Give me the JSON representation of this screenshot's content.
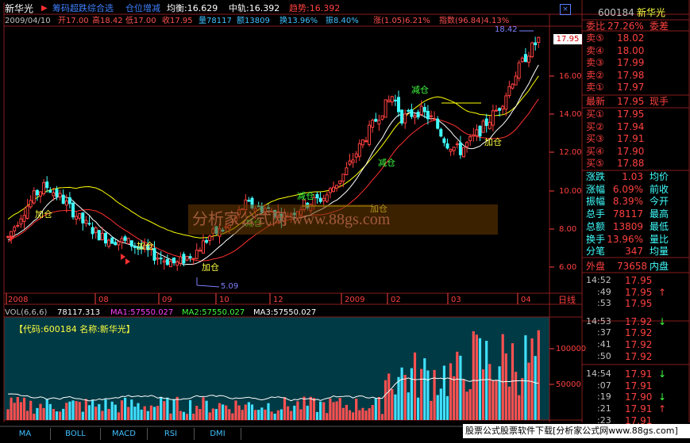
{
  "header": {
    "stock_name": "新华光",
    "indicator_title": "筹码超跌综合选",
    "indicator_sub": "仓位增减",
    "avg_label": "均衡:16.629",
    "mid_label": "中轨:16.392",
    "trend_label": "趋势:16.392"
  },
  "ohlc_line": {
    "date": "2009/04/10",
    "open": "开17.00",
    "high": "高18.42",
    "low": "低17.00",
    "close": "收17.95",
    "volume": "量78117",
    "amount": "额13809",
    "turnover": "换13.96%",
    "amplitude": "振8.40%",
    "change": "涨(1.05)6.21%",
    "index": "指数(96.84)4.13%"
  },
  "price_axis": [
    "16.00",
    "14.00",
    "12.00",
    "10.00",
    "8.00",
    "6.00"
  ],
  "current_price_tag": "17.95",
  "high_marker": "18.42",
  "low_marker": "5.09",
  "signals": [
    {
      "text": "加仓",
      "color": "#ffff40"
    },
    {
      "text": "加仓",
      "color": "#ffff40"
    },
    {
      "text": "加仓",
      "color": "#ffff40"
    },
    {
      "text": "减仓",
      "color": "#40ff40"
    },
    {
      "text": "减仓",
      "color": "#40ff40"
    },
    {
      "text": "加仓",
      "color": "#ffff40"
    },
    {
      "text": "减仓",
      "color": "#40ff40"
    },
    {
      "text": "减仓",
      "color": "#40ff40"
    },
    {
      "text": "加仓",
      "color": "#ffff40"
    }
  ],
  "watermark": "分析家公式网 www.88gs.com",
  "date_axis": [
    "2008",
    "08",
    "09",
    "10",
    "12",
    "2009",
    "02",
    "03",
    "04"
  ],
  "date_axis_right": "日线",
  "vol_line": {
    "label": "VOL(6,6,6)",
    "vol": "78117.313",
    "ma1": "MA1:57550.027",
    "ma2": "MA2:57550.027",
    "ma3": "MA3:57550.027"
  },
  "vol_info": "【代码:600184 名称:新华光】",
  "vol_axis": [
    "100000",
    "50000"
  ],
  "bottom_tabs": [
    "MA",
    "BOLL",
    "MACD",
    "RSI",
    "DMI"
  ],
  "footer_link": "股票公式股票软件下载[分析家公式网www.88gs.com]",
  "panel": {
    "code": "600184",
    "name": "新华光",
    "webi_label": "委比",
    "webi_value": "27.26%",
    "weicha_label": "委差",
    "sells": [
      {
        "label": "卖⑤",
        "price": "18.02"
      },
      {
        "label": "卖④",
        "price": "18.00"
      },
      {
        "label": "卖③",
        "price": "17.99"
      },
      {
        "label": "卖②",
        "price": "17.98"
      },
      {
        "label": "卖①",
        "price": "17.97"
      }
    ],
    "latest_label": "最新",
    "latest_value": "17.95",
    "latest_right": "现手",
    "buys": [
      {
        "label": "买①",
        "price": "17.95"
      },
      {
        "label": "买②",
        "price": "17.94"
      },
      {
        "label": "买③",
        "price": "17.91"
      },
      {
        "label": "买④",
        "price": "17.90"
      },
      {
        "label": "买⑤",
        "price": "17.88"
      }
    ],
    "stats": [
      {
        "label": "涨跌",
        "value": "1.03",
        "right": "均价"
      },
      {
        "label": "涨幅",
        "value": "6.09%",
        "right": "前收"
      },
      {
        "label": "振幅",
        "value": "8.39%",
        "right": "今开"
      },
      {
        "label": "总手",
        "value": "78117",
        "right": "最高"
      },
      {
        "label": "总额",
        "value": "13809",
        "right": "最低"
      },
      {
        "label": "换手",
        "value": "13.96%",
        "right": "量比"
      },
      {
        "label": "分笔",
        "value": "347",
        "right": "均量"
      }
    ],
    "outer_label": "外盘",
    "outer_value": "73658",
    "inner_label": "内盘",
    "ticks": [
      {
        "time": "14:52",
        "price": "17.95",
        "arrow": ""
      },
      {
        "time": ":49",
        "price": "17.95",
        "arrow": "↑"
      },
      {
        "time": ":53",
        "price": "17.95",
        "arrow": ""
      },
      {
        "time": "14:53",
        "price": "17.92",
        "arrow": "↓"
      },
      {
        "time": ":37",
        "price": "17.92",
        "arrow": ""
      },
      {
        "time": ":41",
        "price": "17.92",
        "arrow": ""
      },
      {
        "time": ":50",
        "price": "17.92",
        "arrow": ""
      },
      {
        "time": "14:54",
        "price": "17.91",
        "arrow": "↓"
      },
      {
        "time": ":07",
        "price": "17.91",
        "arrow": ""
      },
      {
        "time": ":19",
        "price": "17.90",
        "arrow": "↓"
      },
      {
        "time": ":21",
        "price": "17.91",
        "arrow": "↑"
      },
      {
        "time": ":23",
        "price": "17.91",
        "arrow": ""
      }
    ]
  },
  "colors": {
    "up": "#ff4040",
    "down": "#40ffff",
    "yellow": "#ffff00",
    "grid": "#8a1c1c",
    "vol_bg": "#003a44"
  }
}
